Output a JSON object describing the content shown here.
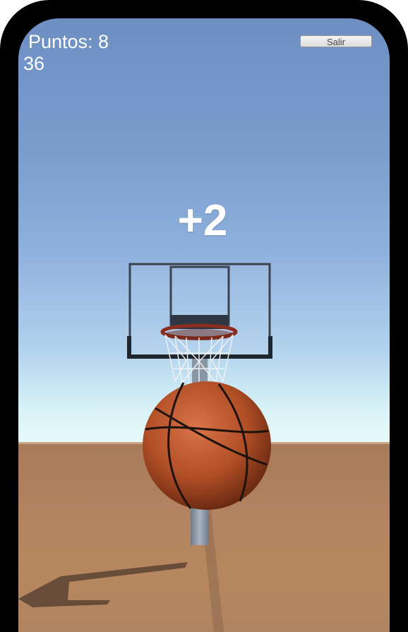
{
  "hud": {
    "score_text": "Puntos: 8",
    "timer_text": "36",
    "exit_label": "Salir"
  },
  "feedback": {
    "points_text": "+2"
  },
  "colors": {
    "sky_top": "#6e8fc2",
    "horizon": "#e7fbfb",
    "floor": "#b38360",
    "ball": "#b5532a",
    "frame": "#000000"
  }
}
